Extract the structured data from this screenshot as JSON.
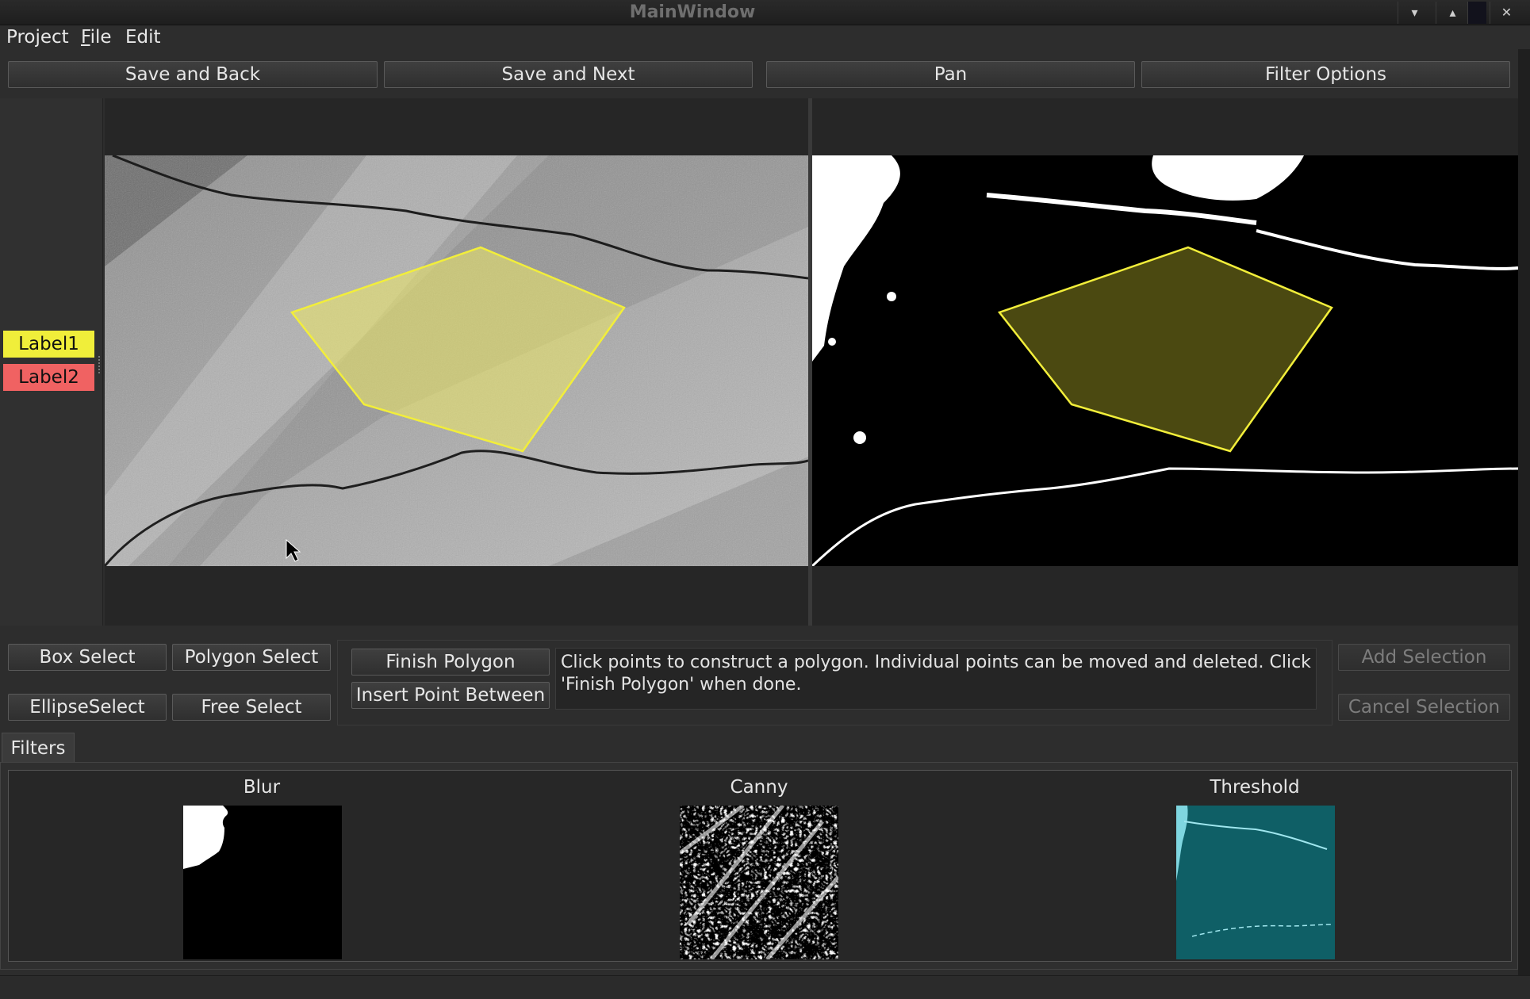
{
  "window": {
    "title": "MainWindow"
  },
  "menu": {
    "project": "Project",
    "file_prefix": "F",
    "file_rest": "ile",
    "edit": "Edit"
  },
  "toolbar": {
    "save_back": "Save and Back",
    "save_next": "Save and Next",
    "pan": "Pan",
    "filter_options": "Filter Options"
  },
  "labels": [
    {
      "name": "Label1",
      "color": "#f0ee3a"
    },
    {
      "name": "Label2",
      "color": "#f06262"
    }
  ],
  "selection_tools": {
    "box": "Box Select",
    "polygon": "Polygon Select",
    "ellipse": "EllipseSelect",
    "free": "Free Select"
  },
  "polygon_tools": {
    "finish": "Finish Polygon",
    "insert": "Insert Point Between",
    "help": "Click points to construct a polygon. Individual points can be moved and deleted. Click 'Finish Polygon' when done."
  },
  "selection_actions": {
    "add": "Add Selection",
    "cancel": "Cancel Selection"
  },
  "filters": {
    "tab": "Filters",
    "items": [
      {
        "name": "Blur"
      },
      {
        "name": "Canny"
      },
      {
        "name": "Threshold"
      }
    ]
  },
  "colors": {
    "polygon": "#f2ee3a",
    "threshold_bg": "#0f5f66"
  }
}
